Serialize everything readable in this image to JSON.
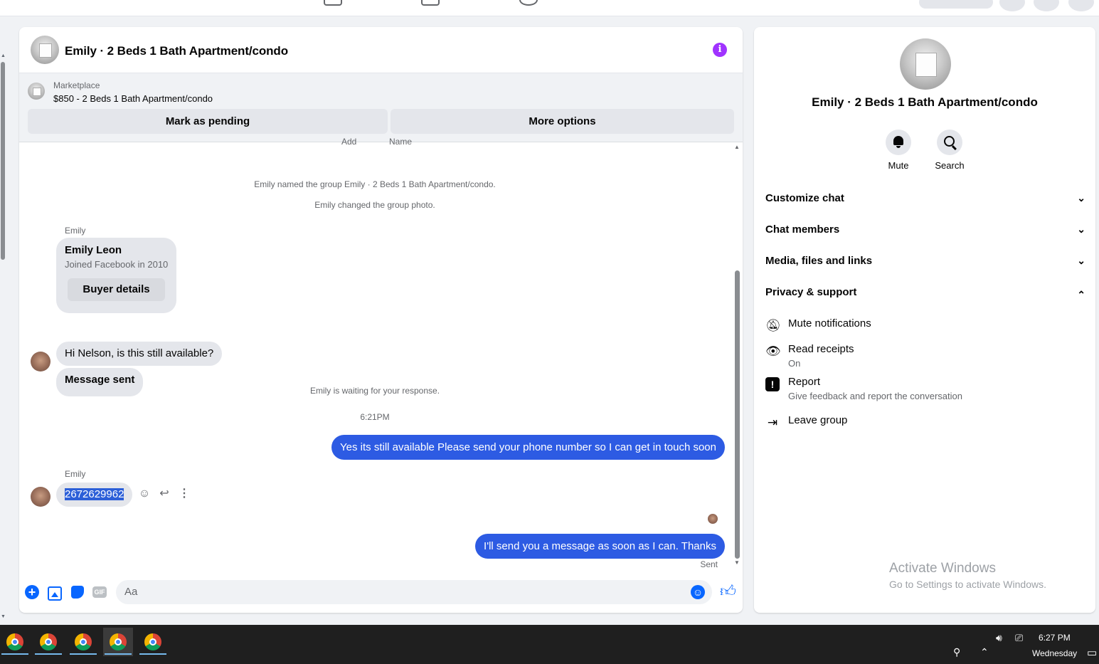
{
  "chat": {
    "title": "Emily · 2 Beds 1 Bath Apartment/condo",
    "info_icon": "i",
    "marketplace": {
      "label": "Marketplace",
      "listing": "$850 - 2 Beds 1 Bath Apartment/condo",
      "mark_pending": "Mark as pending",
      "more_options": "More options"
    },
    "cut_labels": [
      "Add",
      "Name"
    ],
    "system_1": "Emily named the group Emily · 2 Beds 1 Bath Apartment/condo.",
    "system_2": "Emily changed the group photo.",
    "sender_1": "Emily",
    "card": {
      "name": "Emily Leon",
      "subtitle": "Joined Facebook in 2010",
      "button": "Buyer details"
    },
    "msg_1": "Hi Nelson, is this still available?",
    "msg_2": "Message sent",
    "waiting": "Emily is waiting for your response.",
    "time": "6:21PM",
    "out_1": "Yes its still available Please send your phone number so I can get in touch soon",
    "sender_2": "Emily",
    "phone": "2672629962",
    "out_2": "I'll send you a message as soon as I can. Thanks",
    "status": "Sent",
    "composer_placeholder": "Aa",
    "gif_label": "GIF"
  },
  "panel": {
    "title": "Emily · 2 Beds 1 Bath Apartment/condo",
    "mute": "Mute",
    "search": "Search",
    "sections": [
      "Customize chat",
      "Chat members",
      "Media, files and links",
      "Privacy & support"
    ],
    "privacy_items": [
      {
        "title": "Mute notifications",
        "sub": ""
      },
      {
        "title": "Read receipts",
        "sub": "On"
      },
      {
        "title": "Report",
        "sub": "Give feedback and report the conversation"
      },
      {
        "title": "Leave group",
        "sub": ""
      }
    ],
    "watermark_1": "Activate Windows",
    "watermark_2": "Go to Settings to activate Windows."
  },
  "taskbar": {
    "time": "6:27 PM",
    "day": "Wednesday"
  },
  "colors": {
    "outgoing_bubble": "#2d5be3",
    "accent": "#0866ff",
    "info": "#a033ff"
  }
}
